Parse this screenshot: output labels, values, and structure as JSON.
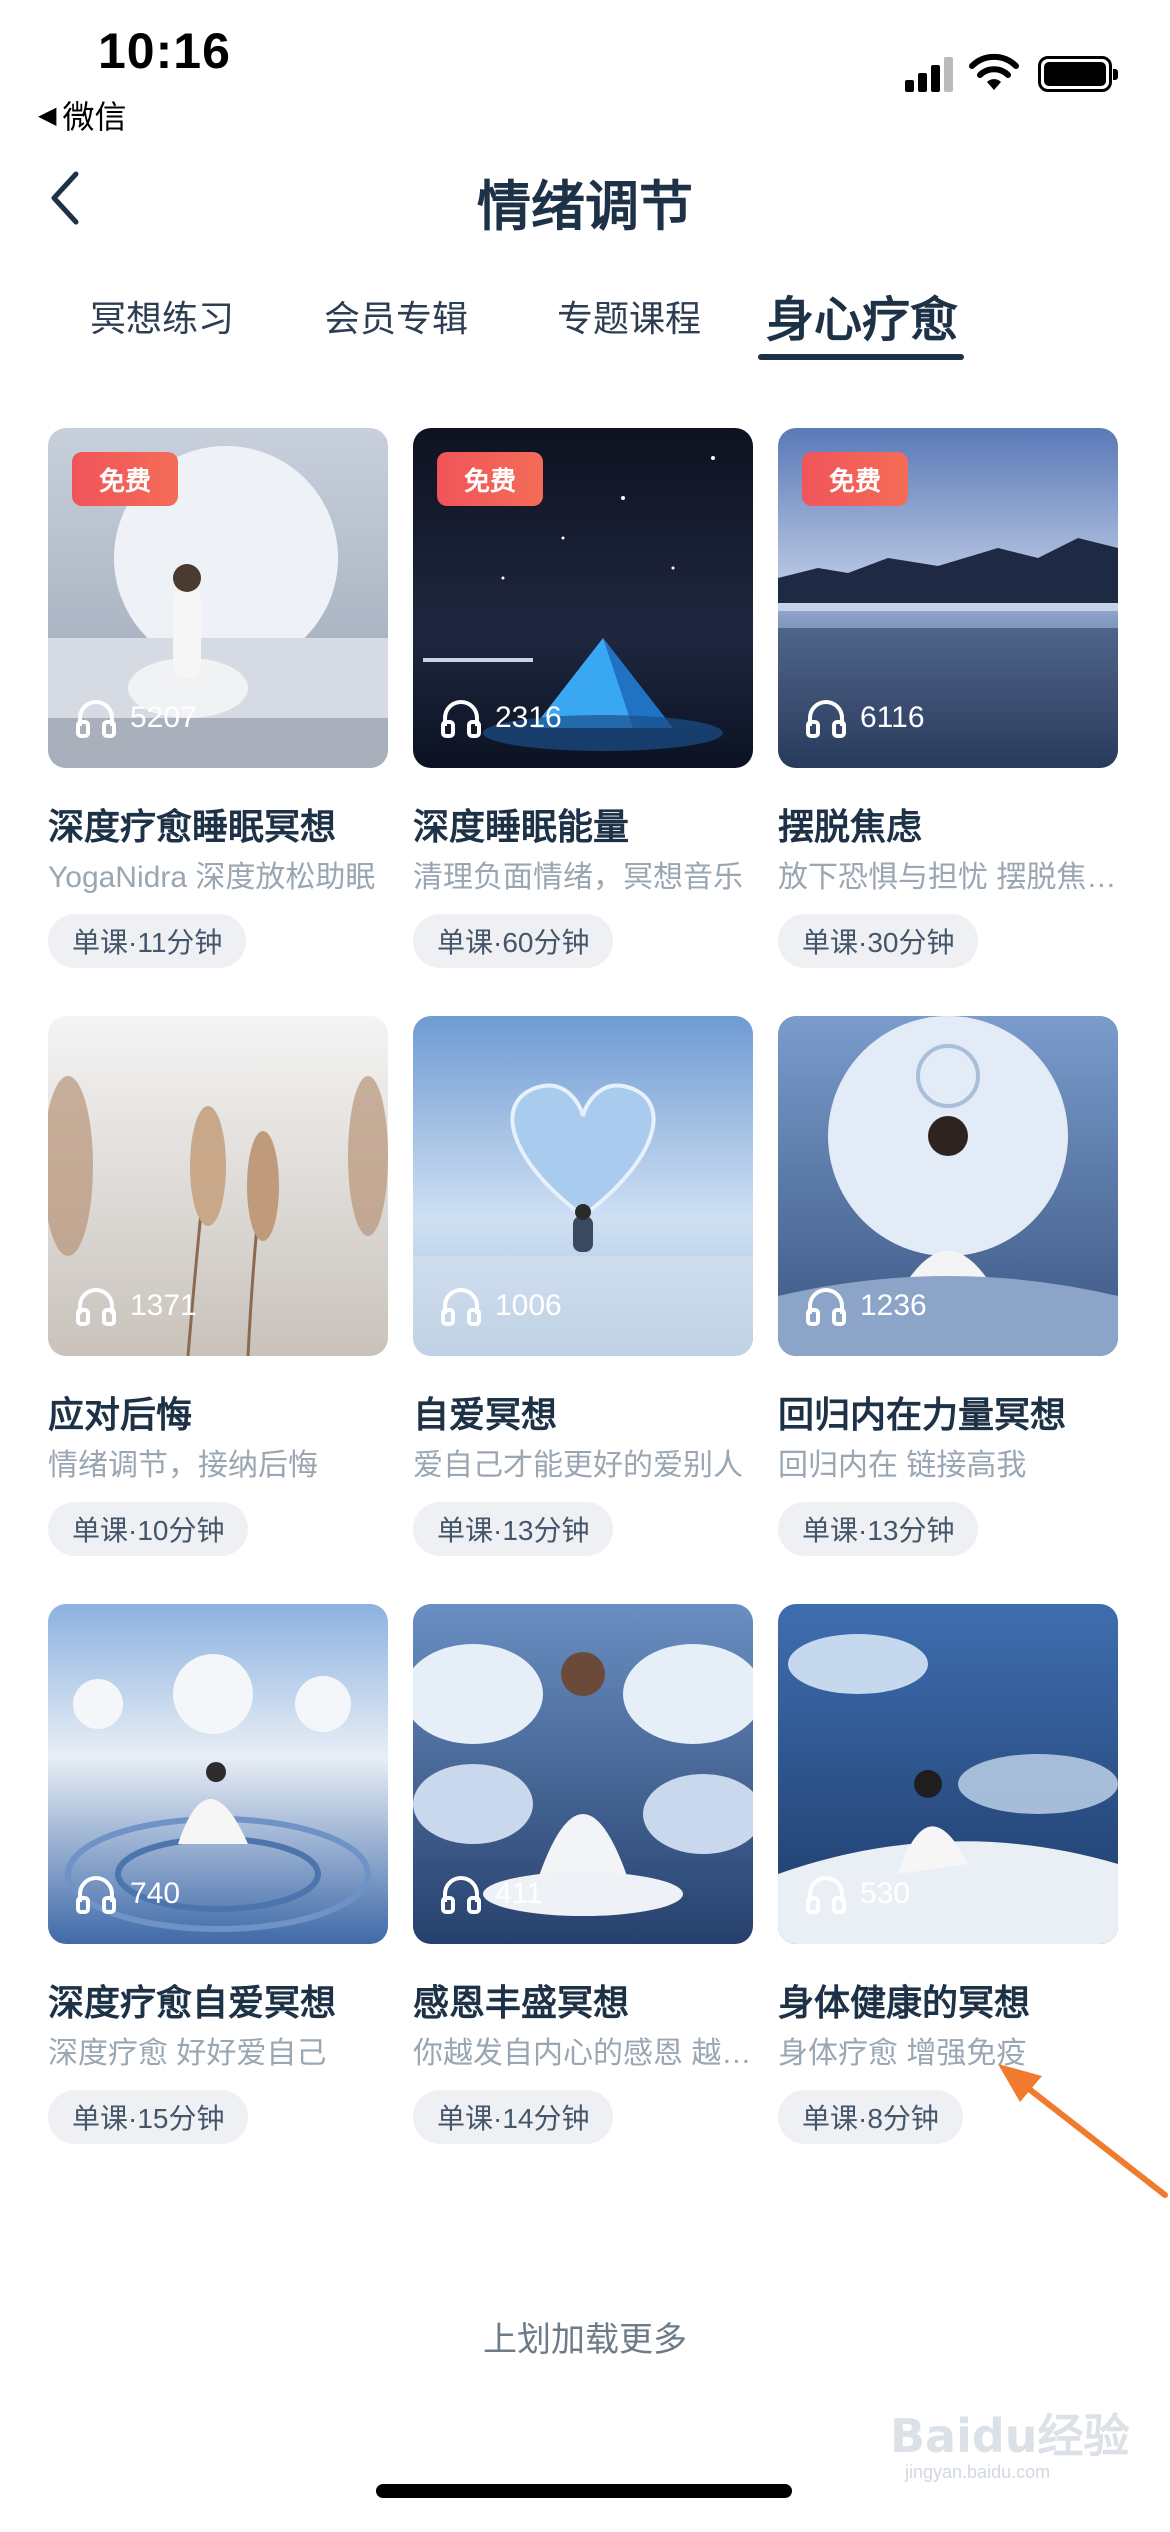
{
  "status_bar": {
    "time": "10:16",
    "back_app": "微信"
  },
  "header": {
    "title": "情绪调节"
  },
  "tabs": [
    {
      "label": "冥想练习"
    },
    {
      "label": "会员专辑"
    },
    {
      "label": "专题课程"
    },
    {
      "label": "身心疗愈"
    }
  ],
  "badge_label": "免费",
  "cards": [
    {
      "title": "深度疗愈睡眠冥想",
      "desc": "YogaNidra  深度放松助眠",
      "plays": "5207",
      "tag": "单课·11分钟",
      "free": true
    },
    {
      "title": "深度睡眠能量",
      "desc": "清理负面情绪，冥想音乐",
      "plays": "2316",
      "tag": "单课·60分钟",
      "free": true
    },
    {
      "title": "摆脱焦虑",
      "desc": "放下恐惧与担忧 摆脱焦虑情绪",
      "plays": "6116",
      "tag": "单课·30分钟",
      "free": true
    },
    {
      "title": "应对后悔",
      "desc": "情绪调节，接纳后悔",
      "plays": "1371",
      "tag": "单课·10分钟",
      "free": false
    },
    {
      "title": "自爱冥想",
      "desc": "爱自己才能更好的爱别人",
      "plays": "1006",
      "tag": "单课·13分钟",
      "free": false
    },
    {
      "title": "回归内在力量冥想",
      "desc": "回归内在 链接高我",
      "plays": "1236",
      "tag": "单课·13分钟",
      "free": false
    },
    {
      "title": "深度疗愈自爱冥想",
      "desc": "深度疗愈 好好爱自己",
      "plays": "740",
      "tag": "单课·15分钟",
      "free": false
    },
    {
      "title": "感恩丰盛冥想",
      "desc": "你越发自内心的感恩 越能吸引丰盛",
      "plays": "411",
      "tag": "单课·14分钟",
      "free": false
    },
    {
      "title": "身体健康的冥想",
      "desc": "身体疗愈 增强免疫",
      "plays": "530",
      "tag": "单课·8分钟",
      "free": false
    }
  ],
  "footer": {
    "load_more": "上划加载更多"
  },
  "watermark": {
    "text": "Baidu经验",
    "sub": "jingyan.baidu.com"
  },
  "colors": {
    "accent": "#1d3147",
    "badge": "#f0545a",
    "annotation": "#f07a2e"
  }
}
